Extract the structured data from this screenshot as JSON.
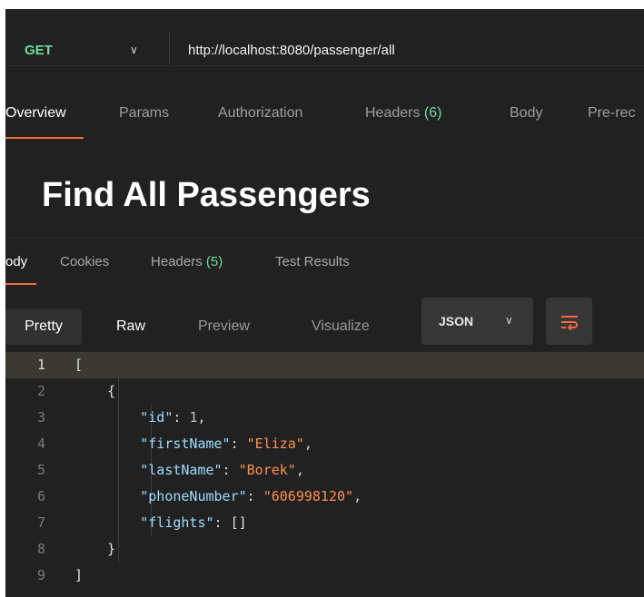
{
  "request": {
    "method": "GET",
    "url": "http://localhost:8080/passenger/all"
  },
  "request_tabs": [
    {
      "label": "Overview",
      "count": ""
    },
    {
      "label": "Params",
      "count": ""
    },
    {
      "label": "Authorization",
      "count": ""
    },
    {
      "label": "Headers ",
      "count": "(6)"
    },
    {
      "label": "Body",
      "count": ""
    },
    {
      "label": "Pre-rec",
      "count": ""
    }
  ],
  "title": "Find All Passengers",
  "response_tabs": [
    {
      "label": "ody",
      "count": ""
    },
    {
      "label": "Cookies",
      "count": ""
    },
    {
      "label": "Headers ",
      "count": "(5)"
    },
    {
      "label": "Test Results",
      "count": ""
    }
  ],
  "view_modes": [
    "Pretty",
    "Raw",
    "Preview",
    "Visualize"
  ],
  "format": "JSON",
  "code_lines": [
    {
      "num": "1",
      "tokens": [
        {
          "t": "[",
          "c": "b"
        }
      ]
    },
    {
      "num": "2",
      "tokens": [
        {
          "t": "    {",
          "c": "b"
        }
      ]
    },
    {
      "num": "3",
      "tokens": [
        {
          "t": "        ",
          "c": "p"
        },
        {
          "t": "\"id\"",
          "c": "k"
        },
        {
          "t": ": ",
          "c": "p"
        },
        {
          "t": "1",
          "c": "n"
        },
        {
          "t": ",",
          "c": "p"
        }
      ]
    },
    {
      "num": "4",
      "tokens": [
        {
          "t": "        ",
          "c": "p"
        },
        {
          "t": "\"firstName\"",
          "c": "k"
        },
        {
          "t": ": ",
          "c": "p"
        },
        {
          "t": "\"Eliza\"",
          "c": "s"
        },
        {
          "t": ",",
          "c": "p"
        }
      ]
    },
    {
      "num": "5",
      "tokens": [
        {
          "t": "        ",
          "c": "p"
        },
        {
          "t": "\"lastName\"",
          "c": "k"
        },
        {
          "t": ": ",
          "c": "p"
        },
        {
          "t": "\"Borek\"",
          "c": "s"
        },
        {
          "t": ",",
          "c": "p"
        }
      ]
    },
    {
      "num": "6",
      "tokens": [
        {
          "t": "        ",
          "c": "p"
        },
        {
          "t": "\"phoneNumber\"",
          "c": "k"
        },
        {
          "t": ": ",
          "c": "p"
        },
        {
          "t": "\"606998120\"",
          "c": "s"
        },
        {
          "t": ",",
          "c": "p"
        }
      ]
    },
    {
      "num": "7",
      "tokens": [
        {
          "t": "        ",
          "c": "p"
        },
        {
          "t": "\"flights\"",
          "c": "k"
        },
        {
          "t": ": ",
          "c": "p"
        },
        {
          "t": "[]",
          "c": "b"
        }
      ]
    },
    {
      "num": "8",
      "tokens": [
        {
          "t": "    }",
          "c": "b"
        }
      ]
    },
    {
      "num": "9",
      "tokens": [
        {
          "t": "]",
          "c": "b"
        }
      ]
    }
  ],
  "colors": {
    "accent": "#f26b3a",
    "method_get": "#6bdd9a",
    "count_badge": "#6bdd9a",
    "json_key": "#9cdcfe",
    "json_string": "#ff8f4d",
    "json_number": "#b5cea8"
  },
  "icons": {
    "method_dropdown": "chevron-down-icon",
    "format_dropdown": "chevron-down-icon",
    "wrap": "wrap-lines-icon"
  }
}
